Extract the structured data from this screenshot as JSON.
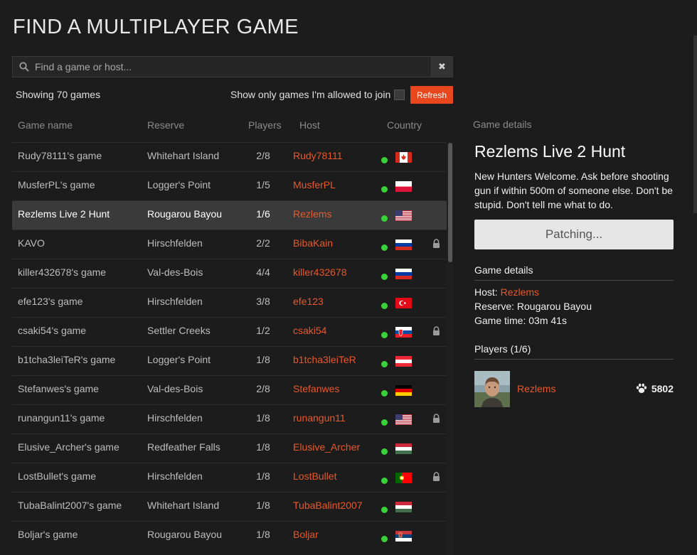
{
  "page": {
    "title": "FIND A MULTIPLAYER GAME"
  },
  "search": {
    "placeholder": "Find a game or host...",
    "value": "",
    "clear_icon": "close-icon"
  },
  "filters": {
    "showing": "Showing 70 games",
    "allowed_label": "Show only games I'm allowed to join",
    "allowed_checked": false,
    "refresh_label": "Refresh"
  },
  "columns": [
    "Game name",
    "Reserve",
    "Players",
    "Host",
    "Country"
  ],
  "games": [
    {
      "name": "Rudy78111's game",
      "reserve": "Whitehart Island",
      "players": "2/8",
      "host": "Rudy78111",
      "country": "canada",
      "locked": false,
      "selected": false
    },
    {
      "name": "MusferPL's game",
      "reserve": "Logger's Point",
      "players": "1/5",
      "host": "MusferPL",
      "country": "poland",
      "locked": false,
      "selected": false
    },
    {
      "name": "Rezlems Live 2 Hunt",
      "reserve": "Rougarou Bayou",
      "players": "1/6",
      "host": "Rezlems",
      "country": "usa",
      "locked": false,
      "selected": true
    },
    {
      "name": "KAVO",
      "reserve": "Hirschfelden",
      "players": "2/2",
      "host": "BibaKain",
      "country": "russia",
      "locked": true,
      "selected": false
    },
    {
      "name": "killer432678's game",
      "reserve": "Val-des-Bois",
      "players": "4/4",
      "host": "killer432678",
      "country": "russia",
      "locked": false,
      "selected": false
    },
    {
      "name": "efe123's game",
      "reserve": "Hirschfelden",
      "players": "3/8",
      "host": "efe123",
      "country": "turkey",
      "locked": false,
      "selected": false
    },
    {
      "name": "csaki54's game",
      "reserve": "Settler Creeks",
      "players": "1/2",
      "host": "csaki54",
      "country": "slovakia",
      "locked": true,
      "selected": false
    },
    {
      "name": "b1tcha3leiTeR's game",
      "reserve": "Logger's Point",
      "players": "1/8",
      "host": "b1tcha3leiTeR",
      "country": "austria",
      "locked": false,
      "selected": false
    },
    {
      "name": "Stefanwes's game",
      "reserve": "Val-des-Bois",
      "players": "2/8",
      "host": "Stefanwes",
      "country": "germany",
      "locked": false,
      "selected": false
    },
    {
      "name": "runangun11's game",
      "reserve": "Hirschfelden",
      "players": "1/8",
      "host": "runangun11",
      "country": "usa",
      "locked": true,
      "selected": false
    },
    {
      "name": "Elusive_Archer's game",
      "reserve": "Redfeather Falls",
      "players": "1/8",
      "host": "Elusive_Archer",
      "country": "hungary",
      "locked": false,
      "selected": false
    },
    {
      "name": "LostBullet's game",
      "reserve": "Hirschfelden",
      "players": "1/8",
      "host": "LostBullet",
      "country": "portugal",
      "locked": true,
      "selected": false
    },
    {
      "name": "TubaBalint2007's game",
      "reserve": "Whitehart Island",
      "players": "1/8",
      "host": "TubaBalint2007",
      "country": "hungary",
      "locked": false,
      "selected": false
    },
    {
      "name": "Boljar's game",
      "reserve": "Rougarou Bayou",
      "players": "1/8",
      "host": "Boljar",
      "country": "serbia",
      "locked": false,
      "selected": false
    }
  ],
  "details": {
    "label": "Game details",
    "title": "Rezlems Live 2 Hunt",
    "description": "New Hunters Welcome. Ask before shooting gun if within 500m of someone else. Don't be stupid. Don't tell me what to do.",
    "action_label": "Patching...",
    "info_heading": "Game details",
    "host_prefix": "Host: ",
    "host": "Rezlems",
    "reserve_line": "Reserve: Rougarou Bayou",
    "time_line": "Game time: 03m 41s",
    "players_heading": "Players (1/6)",
    "players": [
      {
        "name": "Rezlems",
        "score": "5802",
        "icon": "paw-icon"
      }
    ]
  },
  "colors": {
    "accent": "#e8461c",
    "host_text": "#e8582a",
    "online_dot": "#3ad13a",
    "background": "#1c1c1c",
    "selected_row": "#3a3a3a"
  }
}
